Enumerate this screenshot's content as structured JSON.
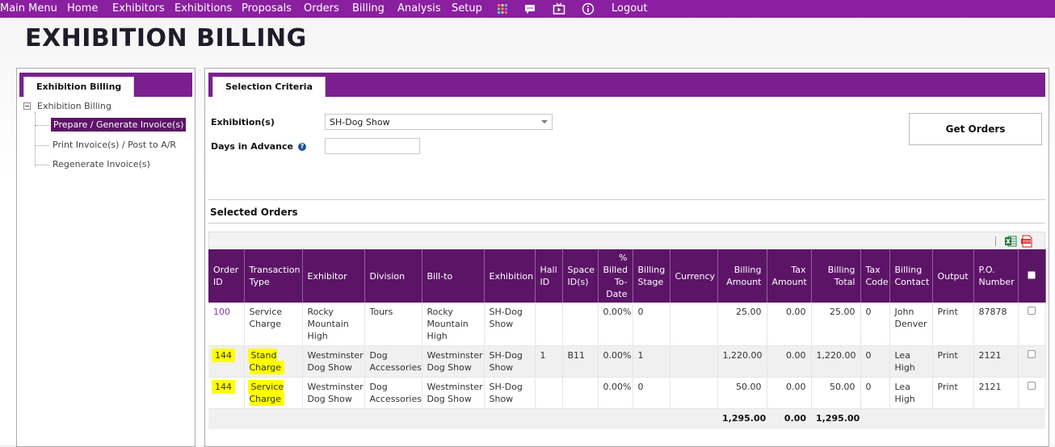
{
  "menu": {
    "items": [
      "Main Menu",
      "Home",
      "Exhibitors",
      "Exhibitions",
      "Proposals",
      "Orders",
      "Billing",
      "Analysis",
      "Setup"
    ],
    "logout": "Logout"
  },
  "page": {
    "title": "EXHIBITION BILLING"
  },
  "left": {
    "tab": "Exhibition Billing",
    "tree_root": "Exhibition Billing",
    "tree_items": [
      "Prepare / Generate Invoice(s)",
      "Print Invoice(s) / Post to A/R",
      "Regenerate Invoice(s)"
    ]
  },
  "right": {
    "tab": "Selection Criteria",
    "exhibition_label": "Exhibition(s)",
    "exhibition_value": "SH-Dog Show",
    "days_label": "Days in Advance",
    "days_value": "",
    "get_orders": "Get Orders",
    "selected_orders": "Selected Orders"
  },
  "grid": {
    "headers": [
      "Order ID",
      "Transaction Type",
      "Exhibitor",
      "Division",
      "Bill-to",
      "Exhibition",
      "Hall ID",
      "Space ID(s)",
      "% Billed To-Date",
      "Billing Stage",
      "Currency",
      "Billing Amount",
      "Tax Amount",
      "Billing Total",
      "Tax Code",
      "Billing Contact",
      "Output",
      "P.O. Number"
    ],
    "rows": [
      {
        "order_id": "100",
        "type": "Service Charge",
        "exhibitor": "Rocky Mountain High",
        "division": "Tours",
        "bill_to": "Rocky Mountain High",
        "exhibition": "SH-Dog Show",
        "hall": "",
        "space": "",
        "billed": "0.00%",
        "stage": "0",
        "currency": "",
        "amount": "25.00",
        "tax": "0.00",
        "total": "25.00",
        "tax_code": "0",
        "contact": "John Denver",
        "output": "Print",
        "po": "87878"
      },
      {
        "order_id": "144",
        "type": "Stand Charge",
        "exhibitor": "Westminster Dog Show",
        "division": "Dog Accessories",
        "bill_to": "Westminster Dog Show",
        "exhibition": "SH-Dog Show",
        "hall": "1",
        "space": "B11",
        "billed": "0.00%",
        "stage": "1",
        "currency": "",
        "amount": "1,220.00",
        "tax": "0.00",
        "total": "1,220.00",
        "tax_code": "0",
        "contact": "Lea High",
        "output": "Print",
        "po": "2121"
      },
      {
        "order_id": "144",
        "type": "Service Charge",
        "exhibitor": "Westminster Dog Show",
        "division": "Dog Accessories",
        "bill_to": "Westminster Dog Show",
        "exhibition": "SH-Dog Show",
        "hall": "",
        "space": "",
        "billed": "0.00%",
        "stage": "0",
        "currency": "",
        "amount": "50.00",
        "tax": "0.00",
        "total": "50.00",
        "tax_code": "0",
        "contact": "Lea High",
        "output": "Print",
        "po": "2121"
      }
    ],
    "totals": {
      "amount": "1,295.00",
      "tax": "0.00",
      "total": "1,295.00"
    }
  },
  "colors": {
    "menu_bar": "#8a1fa0",
    "tab_bar": "#7b1f8e",
    "header": "#5c1467",
    "highlight": "#ffff00"
  }
}
